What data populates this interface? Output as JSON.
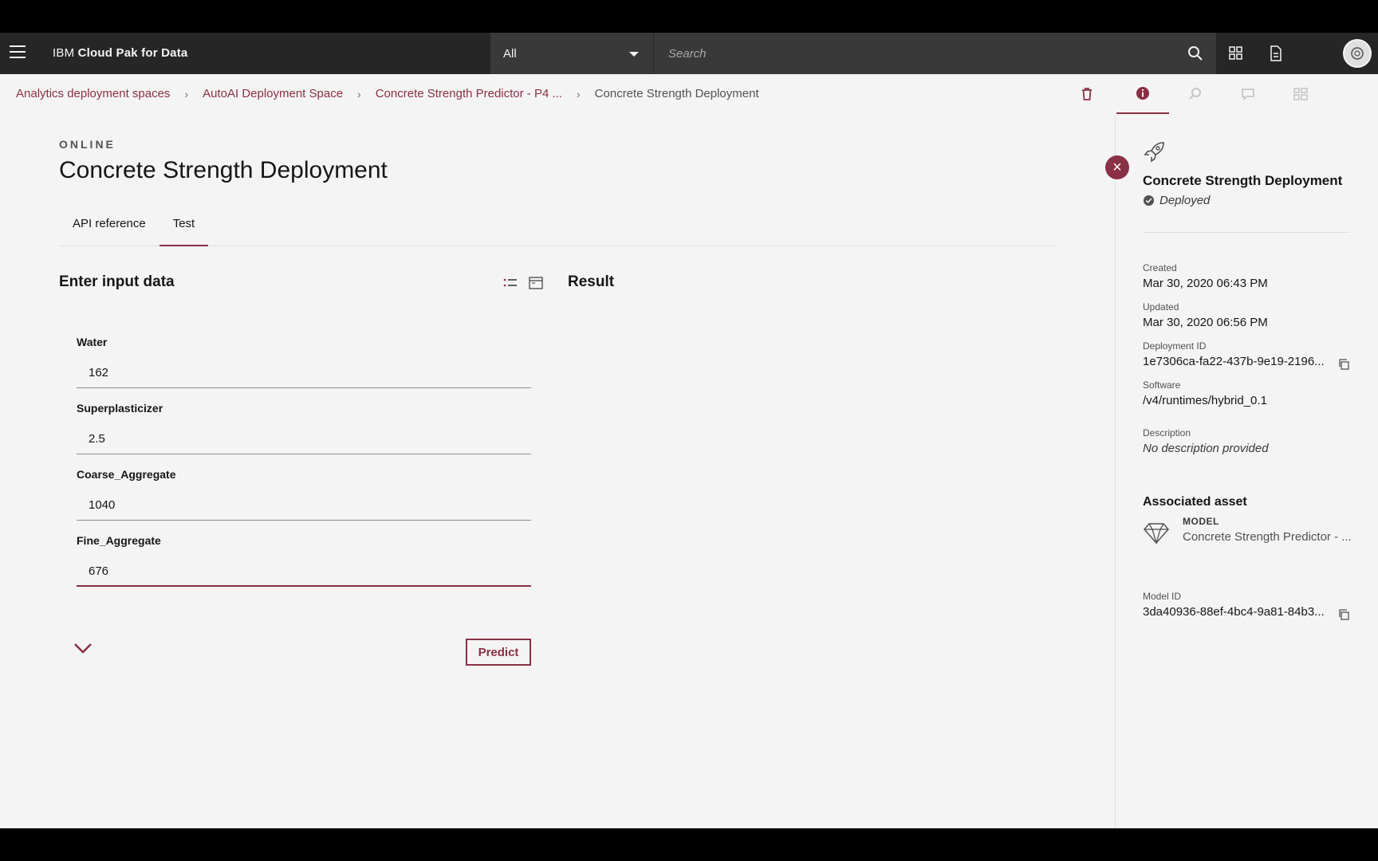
{
  "header": {
    "brand_prefix": "IBM ",
    "brand_name": "Cloud Pak for Data",
    "scope_selected": "All",
    "search_placeholder": "Search"
  },
  "breadcrumb": {
    "items": [
      "Analytics deployment spaces",
      "AutoAI Deployment Space",
      "Concrete Strength Predictor - P4 ...",
      "Concrete Strength Deployment"
    ]
  },
  "main": {
    "eyebrow": "ONLINE",
    "title": "Concrete Strength Deployment",
    "tabs": [
      {
        "label": "API reference"
      },
      {
        "label": "Test"
      }
    ],
    "active_tab": "Test",
    "input_heading": "Enter input data",
    "result_heading": "Result",
    "fields": [
      {
        "label": "Water",
        "value": "162"
      },
      {
        "label": "Superplasticizer",
        "value": "2.5"
      },
      {
        "label": "Coarse_Aggregate",
        "value": "1040"
      },
      {
        "label": "Fine_Aggregate",
        "value": "676"
      }
    ],
    "predict_label": "Predict"
  },
  "side": {
    "name": "Concrete Strength Deployment",
    "status": "Deployed",
    "created_label": "Created",
    "created_value": "Mar 30, 2020 06:43 PM",
    "updated_label": "Updated",
    "updated_value": "Mar 30, 2020 06:56 PM",
    "deployment_id_label": "Deployment ID",
    "deployment_id_value": "1e7306ca-fa22-437b-9e19-2196...",
    "software_label": "Software",
    "software_value": "/v4/runtimes/hybrid_0.1",
    "description_label": "Description",
    "description_value": "No description provided",
    "associated_heading": "Associated asset",
    "asset_kind": "MODEL",
    "asset_name": "Concrete Strength Predictor - ...",
    "model_id_label": "Model ID",
    "model_id_value": "3da40936-88ef-4bc4-9a81-84b3..."
  },
  "colors": {
    "accent": "#8a3045",
    "header_bg": "#262626",
    "page_bg": "#f4f4f4"
  }
}
